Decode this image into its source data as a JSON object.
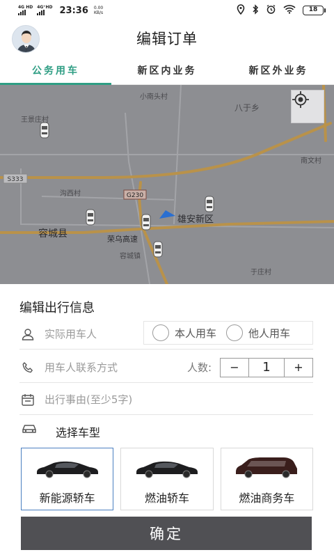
{
  "status_bar": {
    "network_1": "4G HD",
    "network_2": "4G⁺HD",
    "time": "23:36",
    "speed_value": "0.00",
    "speed_unit": "KB/s",
    "battery": "18"
  },
  "header": {
    "title": "编辑订单"
  },
  "tabs": [
    {
      "label": "公务用车",
      "active": true
    },
    {
      "label": "新区内业务",
      "active": false
    },
    {
      "label": "新区外业务",
      "active": false
    }
  ],
  "map": {
    "labels": {
      "xiaonan": "小南头村",
      "bazi": "八于乡",
      "wangjingzhuang": "王景庄村",
      "nanwen": "南文村",
      "s333": "S333",
      "goux": "沟西村",
      "g230": "G230",
      "rongcheng_county": "容城县",
      "xiongan": "雄安新区",
      "rongwu": "荣乌高速",
      "rongcheng_town": "容城镇",
      "yuzhuang": "于庄村"
    }
  },
  "form": {
    "section_title": "编辑出行信息",
    "passenger_placeholder": "实际用车人",
    "radio_self": "本人用车",
    "radio_other": "他人用车",
    "contact_placeholder": "用车人联系方式",
    "people_label": "人数:",
    "people_minus": "−",
    "people_count": "1",
    "people_plus": "+",
    "reason_placeholder": "出行事由(至少5字)",
    "car_type_label": "选择车型",
    "cars": [
      {
        "name": "新能源轿车",
        "selected": true
      },
      {
        "name": "燃油轿车",
        "selected": false
      },
      {
        "name": "燃油商务车",
        "selected": false
      }
    ],
    "confirm_label": "确定"
  }
}
